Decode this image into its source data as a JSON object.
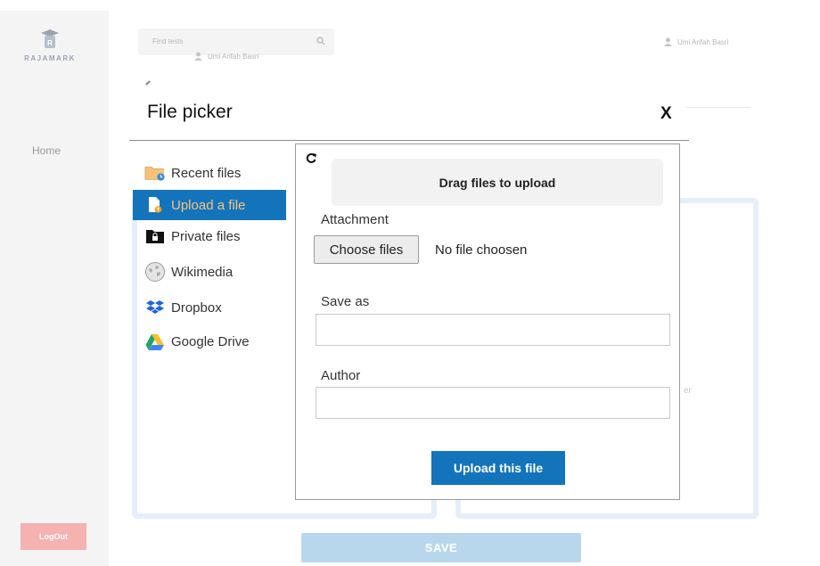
{
  "app": {
    "logo_text": "RAJAMARK",
    "search_placeholder": "Find tests",
    "user_name_left": "Umi Arifah Basri",
    "user_name_right": "Umi Arifah Basri",
    "nav_home": "Home",
    "logout_label": "LogOut",
    "save_label": "SAVE",
    "faint_text": "er"
  },
  "modal": {
    "title": "File picker",
    "close_label": "X",
    "repositories": [
      {
        "label": "Recent files",
        "icon": "folder-clock-icon",
        "active": false
      },
      {
        "label": "Upload a file",
        "icon": "file-upload-icon",
        "active": true
      },
      {
        "label": "Private files",
        "icon": "lock-folder-icon",
        "active": false
      },
      {
        "label": "Wikimedia",
        "icon": "wikipedia-globe-icon",
        "active": false
      },
      {
        "label": "Dropbox",
        "icon": "dropbox-icon",
        "active": false
      },
      {
        "label": "Google Drive",
        "icon": "google-drive-icon",
        "active": false
      }
    ],
    "upload_panel": {
      "dropzone_text": "Drag files to upload",
      "attachment_label": "Attachment",
      "choose_files_label": "Choose files",
      "no_file_text": "No file choosen",
      "save_as_label": "Save as",
      "save_as_value": "",
      "author_label": "Author",
      "author_value": "",
      "upload_button_label": "Upload this file"
    }
  },
  "colors": {
    "accent_blue": "#1474bb",
    "active_text": "#f7c27e",
    "logout_bg": "#f6b1b1",
    "save_bg": "#b8d7ec"
  }
}
